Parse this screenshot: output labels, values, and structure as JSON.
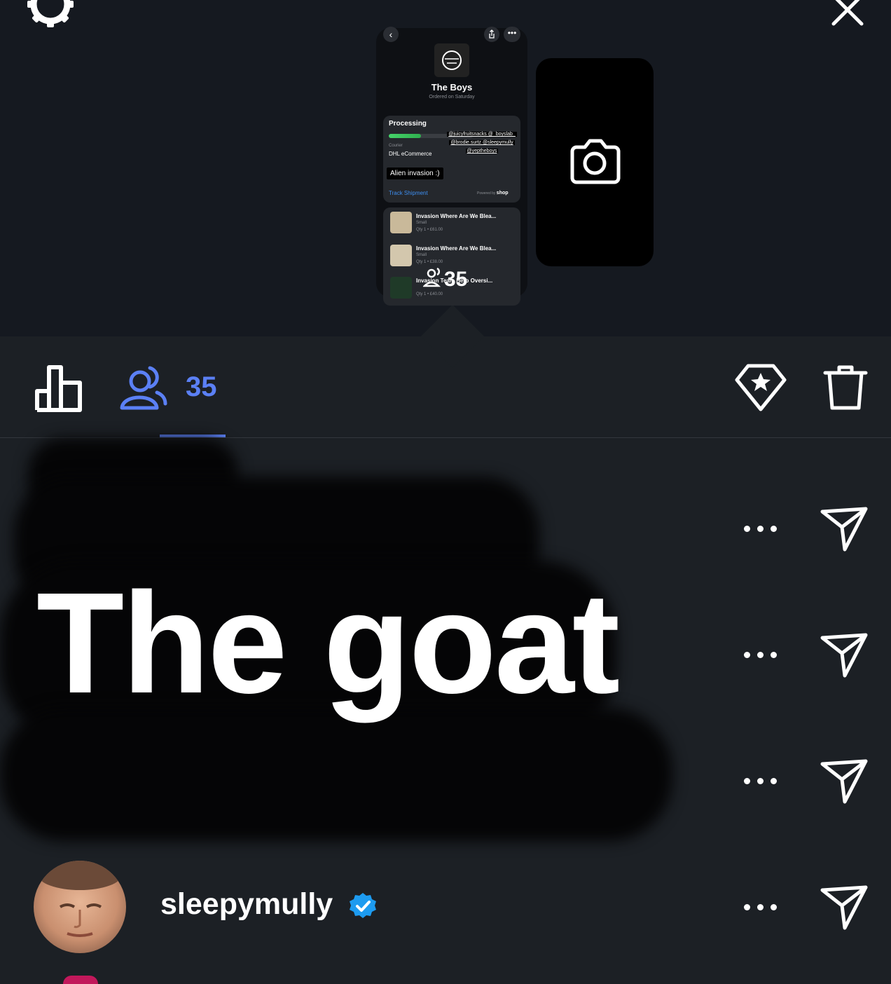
{
  "header": {
    "settings_icon": "gear-icon",
    "close_icon": "close-icon"
  },
  "story_preview": {
    "shop_title": "The Boys",
    "shop_subtitle": "Ordered on Saturday",
    "status": "Processing",
    "progress": 0.38,
    "courier_label": "Courier",
    "courier_value": "DHL eCommerce",
    "mentions": [
      "@juicyfruitsnacks @_boyslab_",
      "@brodie.surtz @sleepymully",
      "@yeptheboys"
    ],
    "sticker_text": "Alien invasion :)",
    "track_link": "Track Shipment",
    "powered_by": "Powered by",
    "powered_brand": "shop",
    "items": [
      {
        "name": "Invasion Where Are We Blea...",
        "size": "Small",
        "qty": "Qty 1 • £61.00"
      },
      {
        "name": "Invasion Where Are We Blea...",
        "size": "Small",
        "qty": "Qty 1 • £38.00"
      },
      {
        "name": "Invasion Team Hero Oversi...",
        "size": "Small",
        "qty": "Qty 1 • £40.00"
      }
    ],
    "viewer_overlay": "35"
  },
  "tabs": {
    "viewers_count": "35"
  },
  "sticker_overlay": "The goat",
  "viewers": [
    {
      "username": "sleepymully",
      "verified": true
    }
  ],
  "colors": {
    "accent": "#5b80f5",
    "background": "#1c2025",
    "verified": "#1d9bf0"
  }
}
